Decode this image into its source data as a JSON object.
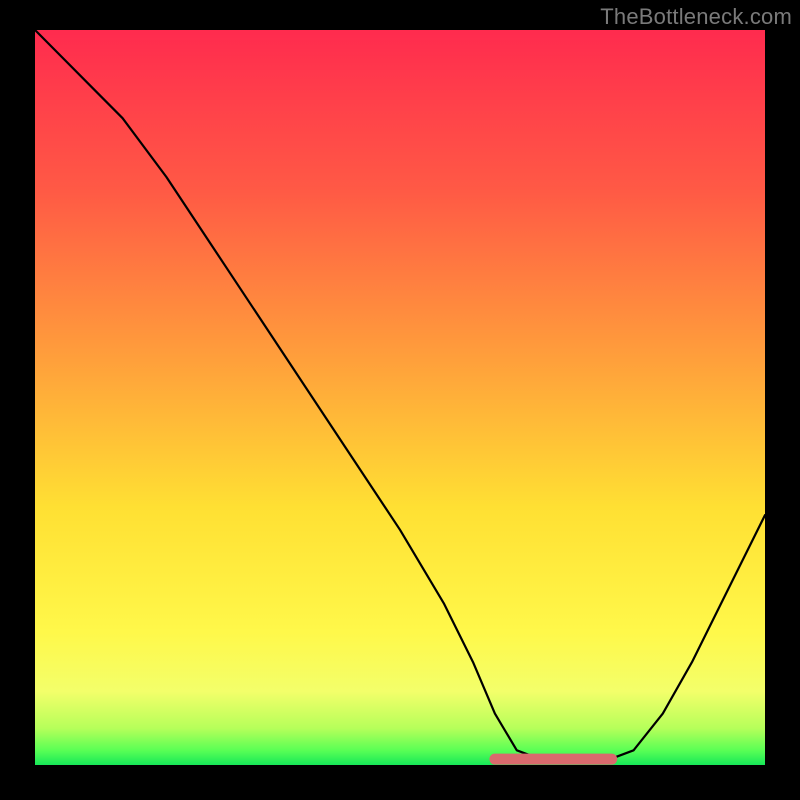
{
  "attribution": "TheBottleneck.com",
  "colors": {
    "gradient": [
      {
        "offset": "0%",
        "color": "#ff2b4e"
      },
      {
        "offset": "22%",
        "color": "#ff5a45"
      },
      {
        "offset": "45%",
        "color": "#ffa03b"
      },
      {
        "offset": "65%",
        "color": "#ffe033"
      },
      {
        "offset": "82%",
        "color": "#fff84a"
      },
      {
        "offset": "90%",
        "color": "#f3ff6a"
      },
      {
        "offset": "95%",
        "color": "#b6ff5a"
      },
      {
        "offset": "98%",
        "color": "#5aff55"
      },
      {
        "offset": "100%",
        "color": "#17e858"
      }
    ],
    "curve_stroke": "#000000",
    "flat_stroke": "#d96a6d",
    "page_bg": "#000000"
  },
  "chart_data": {
    "type": "line",
    "title": "",
    "xlabel": "",
    "ylabel": "",
    "xlim": [
      0,
      100
    ],
    "ylim": [
      0,
      100
    ],
    "x": [
      0,
      4,
      8,
      12,
      18,
      26,
      34,
      42,
      50,
      56,
      60,
      63,
      66,
      70,
      74,
      78,
      82,
      86,
      90,
      94,
      98,
      100
    ],
    "y": [
      100,
      96,
      92,
      88,
      80,
      68,
      56,
      44,
      32,
      22,
      14,
      7,
      2,
      0.5,
      0.5,
      0.5,
      2,
      7,
      14,
      22,
      30,
      34
    ],
    "optimal_flat": {
      "x_start": 63,
      "x_end": 79,
      "y": 0.8
    },
    "note": "x and y are percentages of the plot area; y=0 is the bottom (best / green), y=100 is the top (worst / red). Curve depicts bottleneck severity vs. some swept parameter; the pink segment marks the near-zero plateau (optimal range)."
  }
}
